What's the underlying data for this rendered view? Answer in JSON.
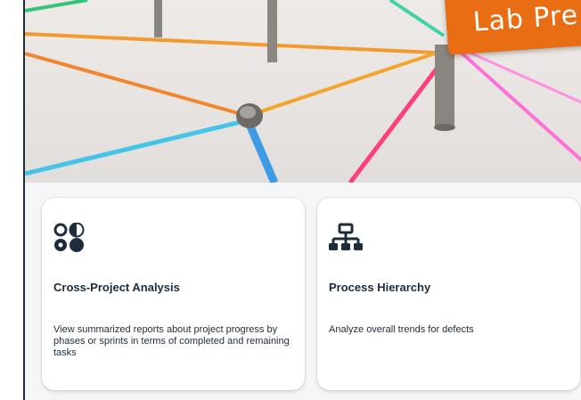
{
  "banner": {
    "ribbon_text": "Lab Pre",
    "ribbon_color": "#e86d13",
    "image_description_icon": "network-pins-image"
  },
  "cards": [
    {
      "icon": "analysis-circles-icon",
      "title": "Cross-Project Analysis",
      "description": "View summarized reports about project progress by phases or sprints in terms of completed and remaining tasks"
    },
    {
      "icon": "hierarchy-icon",
      "title": "Process Hierarchy",
      "description": "Analyze overall trends for defects"
    }
  ],
  "colors": {
    "text": "#1d2d3e",
    "card_background": "#ffffff",
    "page_background": "#f5f6f7"
  }
}
